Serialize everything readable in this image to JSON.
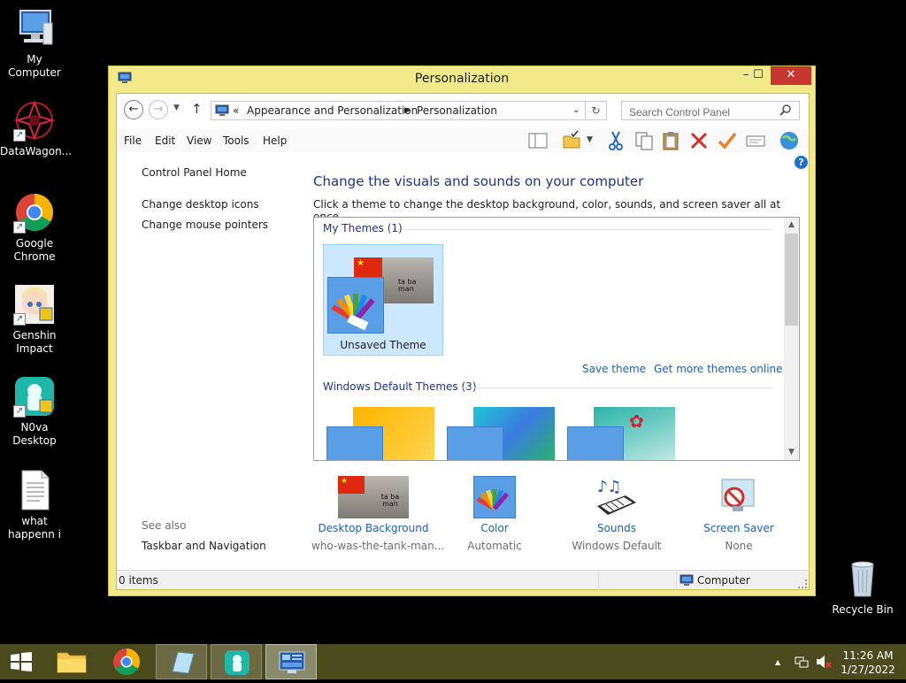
{
  "desktop": {
    "icons": [
      {
        "label": "My Computer"
      },
      {
        "label": "DataWagon..."
      },
      {
        "label": "Google Chrome"
      },
      {
        "label": "Genshin Impact"
      },
      {
        "label": "N0va Desktop"
      },
      {
        "label": "what happenn i"
      },
      {
        "label": "Recycle Bin"
      }
    ]
  },
  "window": {
    "title": "Personalization",
    "controls": {
      "minimize": "–",
      "maximize": "☐",
      "close": "✕"
    },
    "address": {
      "prefix": "«",
      "breadcrumbs": [
        "Appearance and Personalization",
        "Personalization"
      ]
    },
    "search": {
      "placeholder": "Search Control Panel"
    },
    "menu": [
      "File",
      "Edit",
      "View",
      "Tools",
      "Help"
    ],
    "left_pane": {
      "home": "Control Panel Home",
      "links": [
        "Change desktop icons",
        "Change mouse pointers"
      ],
      "see_also_title": "See also",
      "see_also_links": [
        "Taskbar and Navigation"
      ]
    },
    "main": {
      "heading": "Change the visuals and sounds on your computer",
      "subtext": "Click a theme to change the desktop background, color, sounds, and screen saver all at once.",
      "my_themes_header": "My Themes (1)",
      "my_theme_name": "Unsaved Theme",
      "my_theme_image_text": "ta ba man",
      "save_theme": "Save theme",
      "get_more": "Get more themes online",
      "default_themes_header": "Windows Default Themes (3)"
    },
    "bottom": [
      {
        "label": "Desktop Background",
        "sub": "who-was-the-tank-man..."
      },
      {
        "label": "Color",
        "sub": "Automatic"
      },
      {
        "label": "Sounds",
        "sub": "Windows Default"
      },
      {
        "label": "Screen Saver",
        "sub": "None"
      }
    ],
    "status": {
      "items": "0 items",
      "location": "Computer"
    }
  },
  "taskbar": {
    "time": "11:26 AM",
    "date": "1/27/2022",
    "tray_arrow": "▲"
  },
  "colors": {
    "window_frame": "#f2e98a",
    "taskbar": "#4b4a1c",
    "close_button": "#c7372f",
    "link": "#1e5fb4",
    "heading": "#1e3287",
    "selection": "#cce8ff"
  }
}
